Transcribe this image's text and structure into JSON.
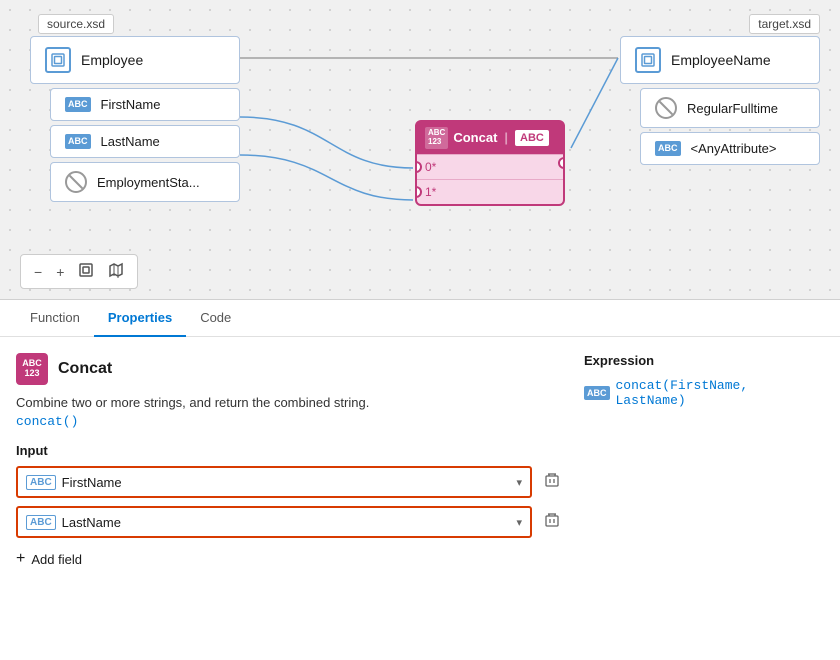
{
  "canvas": {
    "source_label": "source.xsd",
    "target_label": "target.xsd",
    "source_root": "Employee",
    "source_children": [
      {
        "name": "FirstName",
        "type": "abc"
      },
      {
        "name": "LastName",
        "type": "abc"
      },
      {
        "name": "EmploymentSta...",
        "type": "no"
      }
    ],
    "target_root": "EmployeeName",
    "target_children": [
      {
        "name": "RegularFulltime",
        "type": "no"
      },
      {
        "name": "<AnyAttribute>",
        "type": "abc"
      }
    ],
    "concat_node": {
      "title": "Concat",
      "badge": "ABC\n123",
      "right_badge": "ABC",
      "inputs": [
        "0*",
        "1*"
      ]
    }
  },
  "toolbar": {
    "zoom_out": "−",
    "zoom_in": "+",
    "fit": "⊡",
    "map": "⊞"
  },
  "bottom_panel": {
    "tabs": [
      {
        "id": "function",
        "label": "Function",
        "active": false
      },
      {
        "id": "properties",
        "label": "Properties",
        "active": true
      },
      {
        "id": "code",
        "label": "Code",
        "active": false
      }
    ],
    "func_icon_text": "ABC\n123",
    "func_name": "Concat",
    "func_description": "Combine two or more strings, and return the combined string.",
    "func_signature": "concat()",
    "input_label": "Input",
    "inputs": [
      {
        "value": "FirstName"
      },
      {
        "value": "LastName"
      }
    ],
    "add_field_label": "Add field",
    "expression_label": "Expression",
    "expression_value": "concat(FirstName, LastName)"
  }
}
